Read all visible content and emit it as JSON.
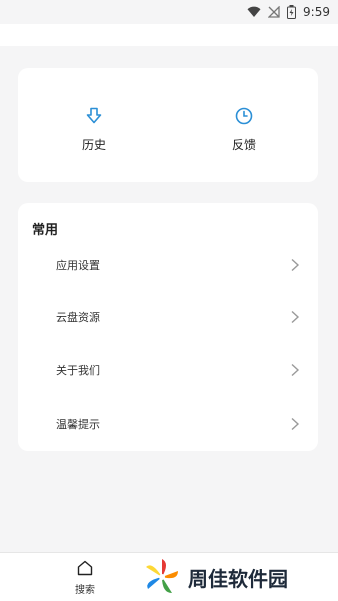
{
  "status_bar": {
    "time": "9:59"
  },
  "quick_actions": [
    {
      "label": "历史",
      "icon": "history-download-icon"
    },
    {
      "label": "反馈",
      "icon": "feedback-clock-icon"
    }
  ],
  "common": {
    "title": "常用",
    "items": [
      {
        "label": "应用设置"
      },
      {
        "label": "云盘资源"
      },
      {
        "label": "关于我们"
      },
      {
        "label": "温馨提示"
      }
    ]
  },
  "tab_bar": {
    "tabs": [
      {
        "label": "搜索",
        "icon": "home-icon"
      }
    ]
  },
  "watermark": {
    "text": "周佳软件园"
  },
  "colors": {
    "accent": "#2b8fd6",
    "background": "#f5f5f6",
    "card": "#ffffff"
  }
}
